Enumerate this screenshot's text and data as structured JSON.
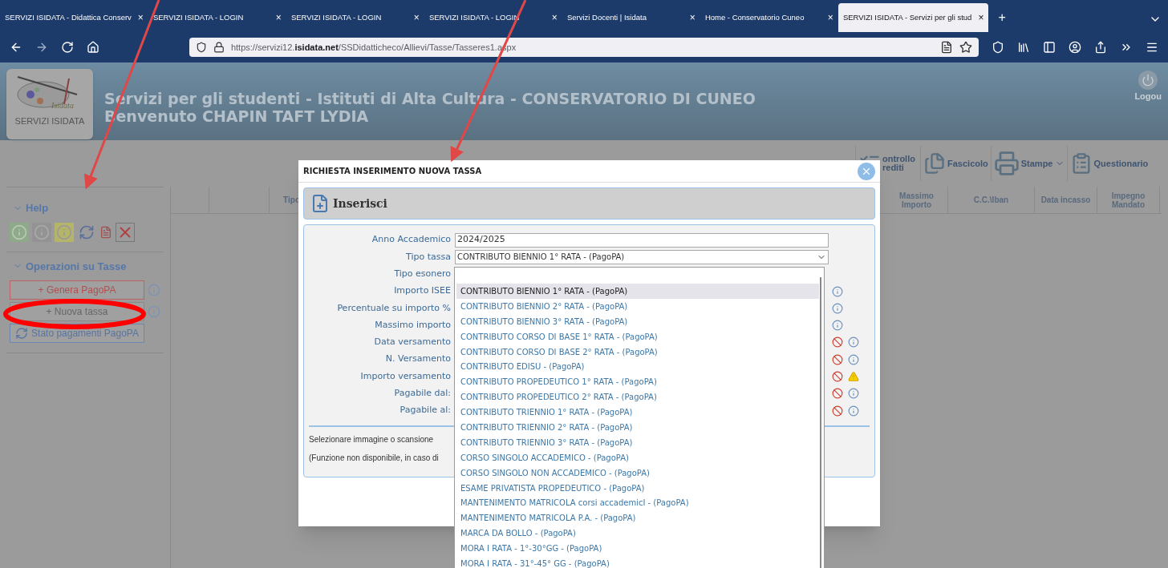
{
  "browser": {
    "tabs": [
      {
        "title": "SERVIZI ISIDATA - Didattica Conserv",
        "close": "×",
        "selected": false
      },
      {
        "title": "SERVIZI ISIDATA - LOGIN",
        "close": "×",
        "selected": false
      },
      {
        "title": "SERVIZI ISIDATA - LOGIN",
        "close": "×",
        "selected": false
      },
      {
        "title": "SERVIZI ISIDATA - LOGIN",
        "close": "×",
        "selected": false
      },
      {
        "title": "Servizi Docenti | Isidata",
        "close": "×",
        "selected": false
      },
      {
        "title": "Home - Conservatorio Cuneo",
        "close": "×",
        "selected": false
      },
      {
        "title": "SERVIZI ISIDATA - Servizi per gli stud",
        "close": "×",
        "selected": true
      }
    ],
    "new_tab": "+",
    "address": "https://servizi12.**isidata.net**/SSDidatticheco/Allievi/Tasse/Tasseres1.aspx"
  },
  "header": {
    "logo_text": "Isidata",
    "logo_caption": "SERVIZI ISIDATA",
    "title": "Servizi per gli studenti - Istituti di Alta Cultura - CONSERVATORIO DI CUNEO",
    "welcome": "Benvenuto CHAPIN TAFT LYDIA",
    "logout": "Logou"
  },
  "toolbar": [
    {
      "label": "ontrollo rediti",
      "kind": "credits",
      "dropdown": false
    },
    {
      "label": "Fascicolo",
      "kind": "file",
      "dropdown": false
    },
    {
      "label": "Stampe",
      "kind": "print",
      "dropdown": true
    },
    {
      "label": "Questionario",
      "kind": "survey",
      "dropdown": false
    }
  ],
  "table": {
    "columns": [
      "Tipo",
      "Massimo Importo",
      "C.C.\\Iban",
      "Data incasso",
      "Impegno Mandato"
    ]
  },
  "sidebar": {
    "sections": [
      {
        "title": "Help",
        "expanded": true
      },
      {
        "title": "Operazioni su Tasse",
        "expanded": true
      }
    ],
    "buttons": [
      {
        "label": "+ Genera PagoPA",
        "kind": "danger"
      },
      {
        "label": "+ Nuova tassa",
        "kind": "plain"
      },
      {
        "label": "Stato pagamenti PagoPA",
        "kind": "status"
      }
    ]
  },
  "modal": {
    "title": "RICHIESTA INSERIMENTO NUOVA TASSA",
    "panel_title": "Inserisci",
    "fields": [
      {
        "label": "Anno Accademico",
        "kind": "text",
        "value": "2024/2025",
        "blocked": false,
        "info": false,
        "warning": false
      },
      {
        "label": "Tipo tassa",
        "kind": "select",
        "value": "CONTRIBUTO BIENNIO 1° RATA - (PagoPA)",
        "blocked": false,
        "info": false,
        "warning": false
      },
      {
        "label": "Tipo esonero",
        "kind": "hidden",
        "blocked": false,
        "info": false,
        "warning": false
      },
      {
        "label": "Importo ISEE",
        "kind": "hidden",
        "blocked": false,
        "info": true,
        "warning": false
      },
      {
        "label": "Percentuale su importo %",
        "kind": "hidden",
        "blocked": false,
        "info": true,
        "warning": false
      },
      {
        "label": "Massimo importo",
        "kind": "hidden",
        "blocked": false,
        "info": true,
        "warning": false
      },
      {
        "label": "Data versamento",
        "kind": "hidden",
        "blocked": true,
        "info": true,
        "warning": false
      },
      {
        "label": "N. Versamento",
        "kind": "hidden",
        "blocked": true,
        "info": true,
        "warning": false
      },
      {
        "label": "Importo versamento",
        "kind": "hidden",
        "blocked": true,
        "info": false,
        "warning": true
      },
      {
        "label": "Pagabile dal:",
        "kind": "hidden",
        "blocked": true,
        "info": true,
        "warning": false
      },
      {
        "label": "Pagabile al:",
        "kind": "hidden",
        "blocked": true,
        "info": true,
        "warning": false
      }
    ],
    "notes": [
      "Selezionare immagine o scansione",
      "(Funzione non disponibile, in caso di"
    ]
  },
  "dropdown": {
    "options": [
      {
        "label": "CONTRIBUTO BIENNIO 1° RATA - (PagoPA)",
        "selected": true
      },
      {
        "label": "CONTRIBUTO BIENNIO 2° RATA - (PagoPA)",
        "selected": false
      },
      {
        "label": "CONTRIBUTO BIENNIO 3° RATA - (PagoPA)",
        "selected": false
      },
      {
        "label": "CONTRIBUTO CORSO DI BASE 1° RATA - (PagoPA)",
        "selected": false
      },
      {
        "label": "CONTRIBUTO CORSO DI BASE 2° RATA - (PagoPA)",
        "selected": false
      },
      {
        "label": "CONTRIBUTO EDISU - (PagoPA)",
        "selected": false
      },
      {
        "label": "CONTRIBUTO PROPEDEUTICO 1° RATA - (PagoPA)",
        "selected": false
      },
      {
        "label": "CONTRIBUTO PROPEDEUTICO 2° RATA - (PagoPA)",
        "selected": false
      },
      {
        "label": "CONTRIBUTO TRIENNIO 1° RATA - (PagoPA)",
        "selected": false
      },
      {
        "label": "CONTRIBUTO TRIENNIO 2° RATA - (PagoPA)",
        "selected": false
      },
      {
        "label": "CONTRIBUTO TRIENNIO 3° RATA - (PagoPA)",
        "selected": false
      },
      {
        "label": "CORSO SINGOLO ACCADEMICO - (PagoPA)",
        "selected": false
      },
      {
        "label": "CORSO SINGOLO NON ACCADEMICO - (PagoPA)",
        "selected": false
      },
      {
        "label": "ESAME PRIVATISTA PROPEDEUTICO - (PagoPA)",
        "selected": false
      },
      {
        "label": "MANTENIMENTO MATRICOLA corsi accademicI - (PagoPA)",
        "selected": false
      },
      {
        "label": "MANTENIMENTO MATRICOLA P.A. - (PagoPA)",
        "selected": false
      },
      {
        "label": "MARCA DA BOLLO - (PagoPA)",
        "selected": false
      },
      {
        "label": "MORA I RATA - 1°-30°GG - (PagoPA)",
        "selected": false
      },
      {
        "label": "MORA I RATA - 31°-45° GG - (PagoPA)",
        "selected": false
      }
    ]
  }
}
